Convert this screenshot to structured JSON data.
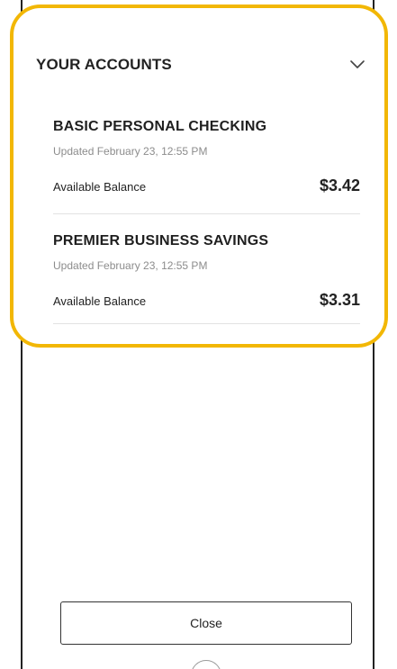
{
  "accounts_panel": {
    "title": "YOUR ACCOUNTS",
    "expand_icon": "chevron-down-icon",
    "highlight_color": "#f2b705",
    "items": [
      {
        "name": "BASIC PERSONAL CHECKING",
        "updated": "Updated February 23, 12:55 PM",
        "balance_label": "Available Balance",
        "balance": "$3.42"
      },
      {
        "name": "PREMIER BUSINESS SAVINGS",
        "updated": "Updated February 23, 12:55 PM",
        "balance_label": "Available Balance",
        "balance": "$3.31"
      }
    ]
  },
  "footer": {
    "close_label": "Close"
  }
}
